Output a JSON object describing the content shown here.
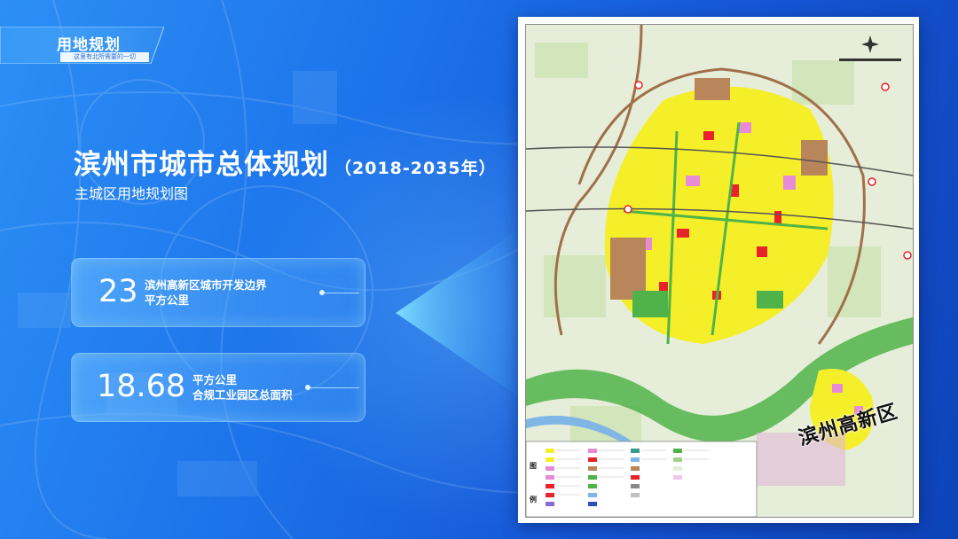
{
  "badge": {
    "title": "用地规划",
    "subtitle": "这里有北所需要的一切"
  },
  "main": {
    "title": "滨州市城市总体规划",
    "years": "（2018-2035年）",
    "subtitle": "主城区用地规划图"
  },
  "stats": [
    {
      "value": "23",
      "line1": "滨州高新区城市开发边界",
      "line2": "平方公里"
    },
    {
      "value": "18.68",
      "line1": "平方公里",
      "line2": "合规工业园区总面积"
    }
  ],
  "map": {
    "district_label": "滨州高新区",
    "legend_label_1": "图",
    "legend_label_2": "例"
  },
  "colors": {
    "residential": "#f5ef2a",
    "commercial": "#e8232a",
    "public": "#e88bd6",
    "industrial": "#b8865a",
    "green": "#4fb34a",
    "water": "#7fb6e6",
    "road_ring": "#a0704a"
  }
}
